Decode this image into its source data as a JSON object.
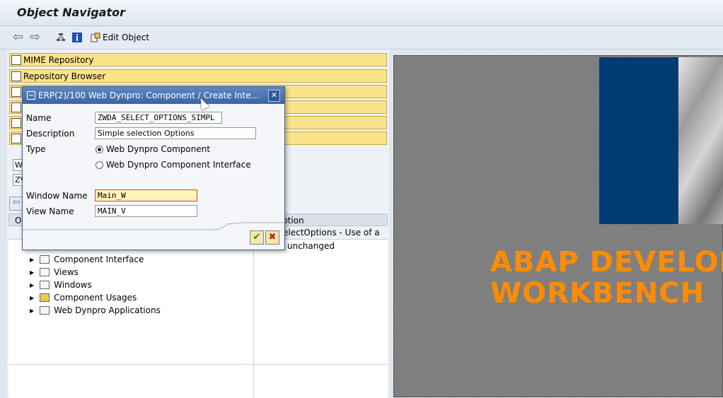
{
  "title": "Object Navigator",
  "toolbar": {
    "edit_object": "Edit Object"
  },
  "left_buttons": [
    "MIME Repository",
    "Repository Browser",
    "",
    "",
    "",
    ""
  ],
  "tree": {
    "col1": "Ob",
    "col2": "ption",
    "desc_line1": "electOptions - Use of a Se",
    "desc_line2": "unchanged",
    "items": [
      "Component Interface",
      "Views",
      "Windows",
      "Component Usages",
      "Web Dynpro Applications"
    ]
  },
  "left_fields": [
    "W",
    "ZV"
  ],
  "dialog": {
    "title": "ERP(2)/100 Web Dynpro: Component / Create Inte...",
    "name_label": "Name",
    "name_value": "ZWDA_SELECT_OPTIONS_SIMPL",
    "description_label": "Description",
    "description_value": "Simple selection Options",
    "type_label": "Type",
    "type_options": [
      "Web Dynpro Component",
      "Web Dynpro Component Interface"
    ],
    "window_label": "Window Name",
    "window_value": "Main_W",
    "view_label": "View Name",
    "view_value": "MAIN_V",
    "ok_symbol": "✔",
    "cancel_symbol": "✖"
  },
  "banner": {
    "line1": "ABAP DEVELOPER",
    "line2": "WORKBENCH"
  },
  "colors": {
    "accent_orange": "#ff8c00",
    "banner_blue": "#003c74",
    "button_yellow": "#fbe38a"
  }
}
